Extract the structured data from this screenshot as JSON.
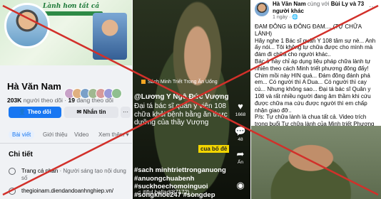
{
  "left_profile": {
    "cover_title": "Lành hơn tất cả",
    "name": "Hà Văn Nam",
    "followers_count": "203K",
    "followers_label": "người theo dõi",
    "following_count": "19",
    "following_label": "đang theo dõi",
    "follow_label": "Theo dõi",
    "message_label": "Nhắn tin",
    "more_label": "···",
    "tabs": [
      "Bài viết",
      "Giới thiệu",
      "Video",
      "Xem thêm ▾"
    ],
    "section_title": "Chi tiết",
    "detail_page_prefix": "Trang cá nhân",
    "detail_page_text": " · Người sáng tạo nội dung số",
    "website": "thegioinam.diendandoanhnghiep.vn/"
  },
  "middle_video": {
    "channel": "Sách Minh Triết Trong Ăn Uống",
    "username": "@Lương Y Ngô Đức Vượng",
    "caption": "Đại tá bác sĩ quân y viện 108 chữa khỏi bệnh bằng ăn thực dưỡng của thầy Vượng",
    "hashtags": "#sach minhtriettronganuong #anuongchuabenh #suckhoechomoinguoi #songkhoe247 #songdep #chuaungthu #songkhoe",
    "overlay_text": "cua bố đê",
    "music": "♫ itiful ballad(87172) ·",
    "likes": "1668",
    "comments": "48",
    "shares_label": "Ấn"
  },
  "right_post": {
    "author": "Hà Văn Nam",
    "with_word": "cùng với",
    "tagged": "Bùi Ly",
    "and_others": "và 73 người khác",
    "time": "1 ngày · 🌐",
    "dots": "···",
    "body": [
      "ĐAM ĐÔNG là ĐÔNG ĐẠM.... (TỰ CHỮA LÀNH)",
      "Hãy nghe 1 Bác sĩ quân Y 108 tâm sự nè... Anh ấy nói... Tôi không tự chữa được cho mình mà đám đi chữa cho người khác..",
      "Bác ở này chỉ áp dụng liệu pháp chữa lành tự nhiên theo cách Minh triết phương đông đấy!",
      "Chim mồi này HIN quá... Đám đông đánh phá em... Có người thì A Dua... Có người thì cay cú... Nhưng không sao... Đại tá bác sĩ Quân y 108 và rất nhiều người đang âm thầm khi cứu được chữa ma cứu được người thì em chấp nhận giao đỡ..",
      "P/s: Tự chữa lành là chua tất cả. Video trích trong buổi Tự chữa lành của Minh triết Phương đông!"
    ]
  },
  "colors": {
    "facebook_blue": "#1877f2",
    "cross_red": "#d2302a",
    "hashtag_highlight": "#f3d500"
  }
}
